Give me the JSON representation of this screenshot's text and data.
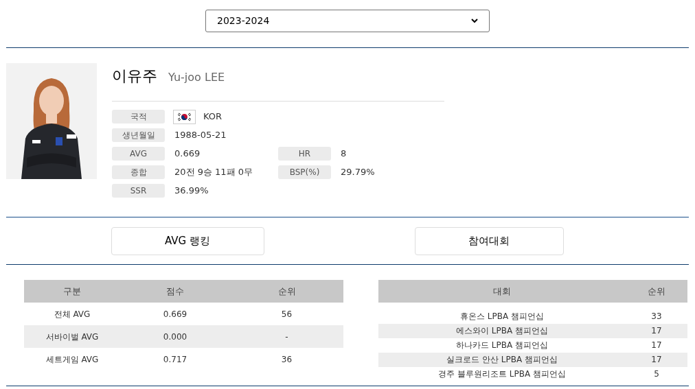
{
  "season_select": {
    "value": "2023-2024"
  },
  "player": {
    "name_ko": "이유주",
    "name_en": "Yu-joo LEE",
    "stat_rows": [
      [
        {
          "label": "국적",
          "value": "KOR",
          "kind": "flag"
        }
      ],
      [
        {
          "label": "생년월일",
          "value": "1988-05-21",
          "kind": "text"
        }
      ],
      [
        {
          "label": "AVG",
          "value": "0.669",
          "kind": "text"
        },
        {
          "label": "HR",
          "value": "8",
          "kind": "text"
        }
      ],
      [
        {
          "label": "종합",
          "value": "20전 9승 11패 0무",
          "kind": "text"
        },
        {
          "label": "BSP(%)",
          "value": "29.79%",
          "kind": "text"
        }
      ],
      [
        {
          "label": "SSR",
          "value": "36.99%",
          "kind": "text"
        }
      ]
    ]
  },
  "buttons": [
    "AVG 랭킹",
    "참여대회"
  ],
  "avg_table": {
    "columns": [
      "구분",
      "점수",
      "순위"
    ],
    "rows": [
      [
        "전체 AVG",
        "0.669",
        "56"
      ],
      [
        "서바이벌 AVG",
        "0.000",
        "-"
      ],
      [
        "세트게임 AVG",
        "0.717",
        "36"
      ]
    ]
  },
  "tournament_table": {
    "columns": [
      "대회",
      "순위"
    ],
    "rows": [
      [
        "휴온스 LPBA 챔피언십",
        "33"
      ],
      [
        "에스와이 LPBA 챔피언십",
        "17"
      ],
      [
        "하나카드 LPBA 챔피언십",
        "17"
      ],
      [
        "실크로드 안산 LPBA 챔피언십",
        "17"
      ],
      [
        "경주 블루원리조트 LPBA 챔피언십",
        "5"
      ]
    ]
  }
}
